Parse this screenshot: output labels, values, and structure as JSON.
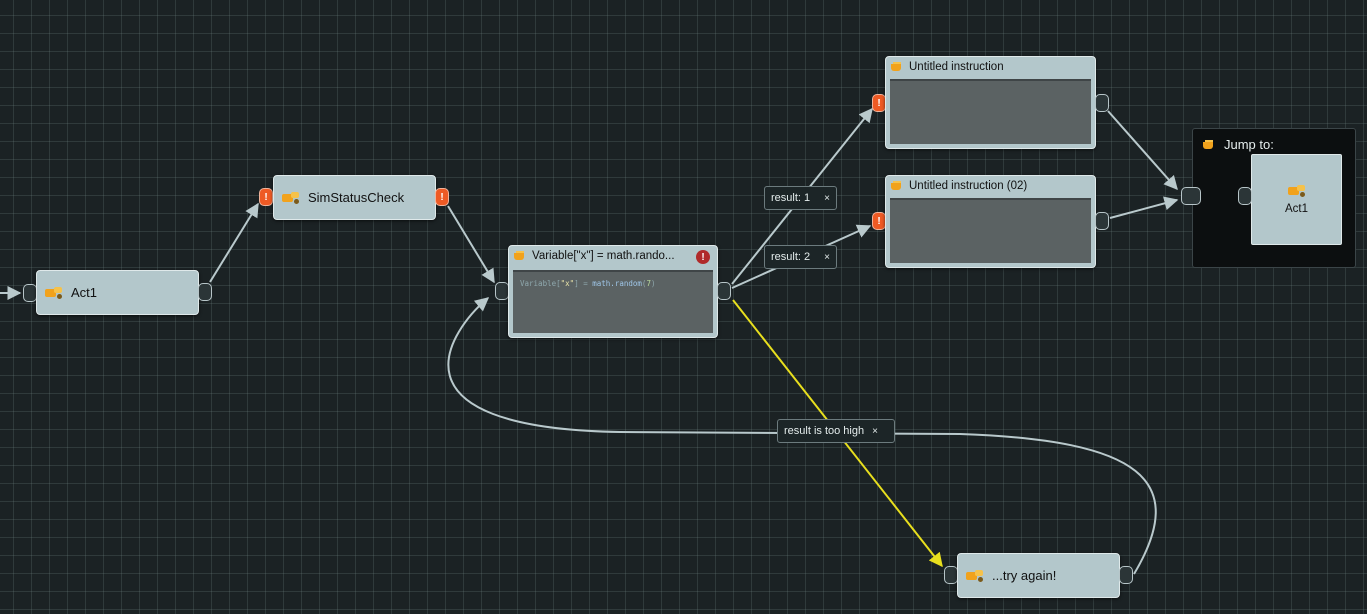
{
  "nodes": {
    "act1": {
      "title": "Act1",
      "icon": "dialog-icon"
    },
    "sim_status_check": {
      "title": "SimStatusCheck",
      "icon": "dialog-icon"
    },
    "variable": {
      "title": "Variable[\"x\"] = math.rando...",
      "icon": "script-icon",
      "code": {
        "a": "Variable[",
        "b": "\"x\"",
        "c": "] = ",
        "d": "math.random",
        "e": "(",
        "f": "7",
        "g": ")"
      }
    },
    "untitled1": {
      "title": "Untitled instruction",
      "icon": "script-icon"
    },
    "untitled2": {
      "title": "Untitled instruction (02)",
      "icon": "script-icon"
    },
    "try_again": {
      "title": "...try again!",
      "icon": "dialog-icon"
    },
    "jump": {
      "title": "Jump to:",
      "target_label": "Act1"
    }
  },
  "edge_labels": {
    "result1": "result: 1",
    "result2": "result: 2",
    "too_high": "result is too high",
    "remove_glyph": "×"
  },
  "status": {
    "warning_glyph": "!",
    "error_glyph": "!"
  },
  "colors": {
    "wire": "#b9c9cc",
    "wire_active": "#e8df1e",
    "warning": "#ee5a24",
    "error": "#b02a2a",
    "node": "#b3c7cb"
  }
}
